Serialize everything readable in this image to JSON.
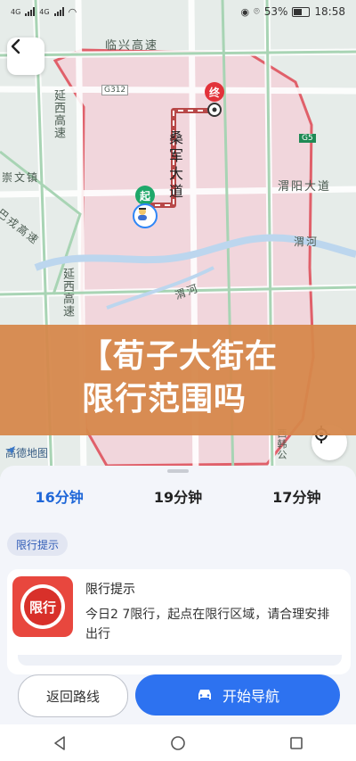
{
  "status_bar": {
    "left_network": "4G",
    "left_network_2": "4G",
    "battery": "53%",
    "time": "18:58"
  },
  "map": {
    "road_labels": {
      "linxing": "临兴高速",
      "yanxi_top": "延西高速",
      "chongwen": "崇文镇",
      "bashu": "巴戎高速",
      "yanxi_bottom": "延西高速",
      "sangjun": "桑军大道",
      "weiyang": "渭阳大道",
      "weihe_right": "渭河",
      "weihe_mid": "渭河",
      "g_label_1": "G312",
      "g_label_2": "G5",
      "right_vertical": "西韩公"
    },
    "pin_end": "终",
    "pin_start": "起",
    "logo": "高德地图"
  },
  "banner": {
    "line1": "【荀子大街在",
    "line2": "限行范围吗"
  },
  "routes": {
    "tabs": [
      {
        "label": "16分钟"
      },
      {
        "label": "19分钟"
      },
      {
        "label": "17分钟"
      }
    ]
  },
  "notice": {
    "chip": "限行提示",
    "icon_text": "限行",
    "title": "限行提示",
    "body": "今日2 7限行，起点在限行区域，请合理安排出行"
  },
  "actions": {
    "back_route": "返回路线",
    "start_nav": "开始导航"
  },
  "colors": {
    "accent": "#2d72f0",
    "restriction_red": "#e2323a",
    "banner_bg": "#d6874a"
  }
}
